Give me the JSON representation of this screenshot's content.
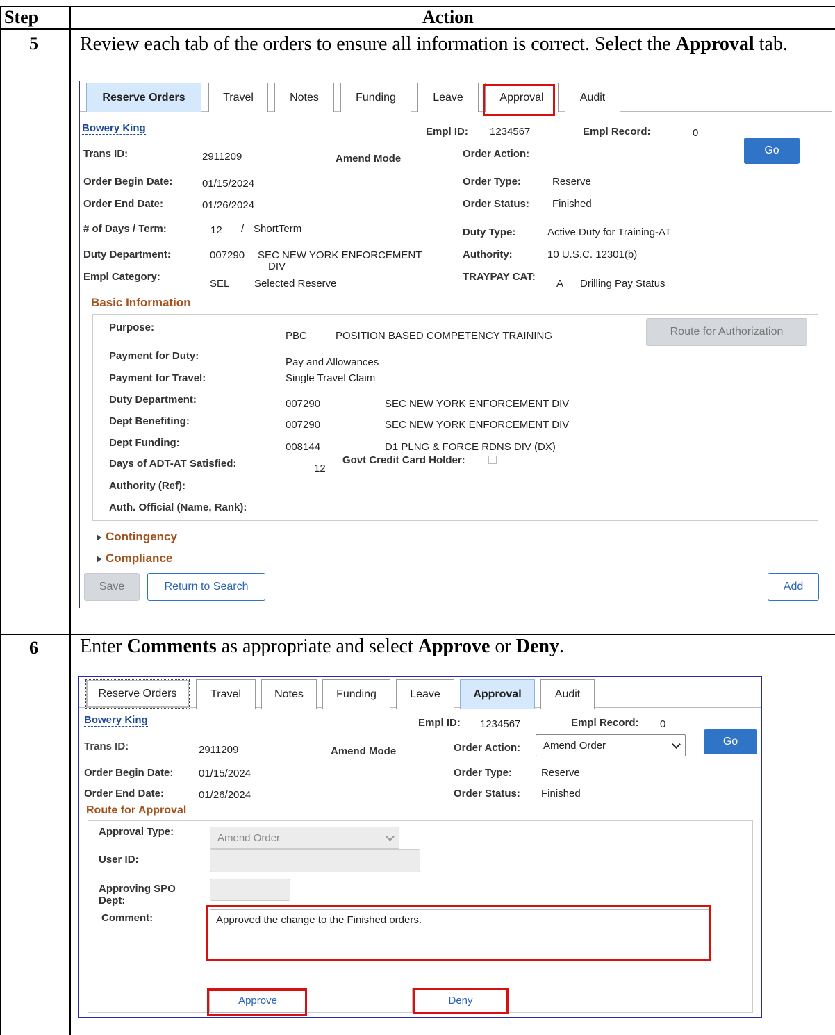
{
  "table": {
    "header_step": "Step",
    "header_action": "Action"
  },
  "step5": {
    "number": "5",
    "text_before": "Review each tab of the orders to ensure all information is correct. Select the ",
    "text_bold": "Approval",
    "text_after": " tab."
  },
  "step6": {
    "number": "6",
    "text_1": "Enter ",
    "bold_1": "Comments",
    "text_2": " as appropriate and select ",
    "bold_2": "Approve",
    "text_3": " or ",
    "bold_3": "Deny",
    "text_4": "."
  },
  "tabs": [
    "Reserve Orders",
    "Travel",
    "Notes",
    "Funding",
    "Leave",
    "Approval",
    "Audit"
  ],
  "shot1": {
    "employee_name": "Bowery King",
    "empl_id_label": "Empl ID:",
    "empl_id": "1234567",
    "empl_record_label": "Empl Record:",
    "empl_record": "0",
    "go_label": "Go",
    "trans_id_label": "Trans ID:",
    "trans_id": "2911209",
    "mode": "Amend Mode",
    "order_action_label": "Order Action:",
    "begin_label": "Order Begin Date:",
    "begin": "01/15/2024",
    "order_type_label": "Order Type:",
    "order_type": "Reserve",
    "end_label": "Order End Date:",
    "end": "01/26/2024",
    "order_status_label": "Order Status:",
    "order_status": "Finished",
    "days_label": "# of Days / Term:",
    "days": "12",
    "term_sep": "/",
    "term": "ShortTerm",
    "duty_type_label": "Duty Type:",
    "duty_type": "Active Duty for Training-AT",
    "duty_dept_label": "Duty Department:",
    "duty_dept_code": "007290",
    "duty_dept_name_1": "SEC NEW YORK ENFORCEMENT",
    "duty_dept_name_2": "DIV",
    "authority_label": "Authority:",
    "authority": "10 U.S.C. 12301(b)",
    "empl_cat_label": "Empl Category:",
    "empl_cat_code": "SEL",
    "empl_cat": "Selected Reserve",
    "traypay_label": "TRAYPAY CAT:",
    "traypay_code": "A",
    "traypay": "Drilling Pay Status",
    "basic_info_title": "Basic Information",
    "purpose_label": "Purpose:",
    "purpose_code": "PBC",
    "purpose": "POSITION BASED COMPETENCY TRAINING",
    "route_auth_label": "Route for Authorization",
    "pay_duty_label": "Payment for Duty:",
    "pay_duty": "Pay and Allowances",
    "pay_travel_label": "Payment for Travel:",
    "pay_travel": "Single Travel Claim",
    "bi_duty_dept_label": "Duty Department:",
    "bi_duty_dept_code": "007290",
    "bi_duty_dept": "SEC NEW YORK ENFORCEMENT DIV",
    "dept_benef_label": "Dept Benefiting:",
    "dept_benef_code": "007290",
    "dept_benef": "SEC NEW YORK ENFORCEMENT DIV",
    "dept_fund_label": "Dept Funding:",
    "dept_fund_code": "008144",
    "dept_fund": "D1 PLNG & FORCE RDNS DIV (DX)",
    "days_sat_label": "Days of ADT-AT Satisfied:",
    "days_sat": "12",
    "govt_cc_label": "Govt Credit Card Holder:",
    "authority_ref_label": "Authority (Ref):",
    "auth_official_label": "Auth. Official (Name, Rank):",
    "contingency": "Contingency",
    "compliance": "Compliance",
    "save_label": "Save",
    "return_label": "Return to Search",
    "add_label": "Add"
  },
  "shot2": {
    "employee_name": "Bowery King",
    "empl_id_label": "Empl ID:",
    "empl_id": "1234567",
    "empl_record_label": "Empl Record:",
    "empl_record": "0",
    "go_label": "Go",
    "trans_id_label": "Trans ID:",
    "trans_id": "2911209",
    "mode": "Amend Mode",
    "order_action_label": "Order Action:",
    "order_action": "Amend Order",
    "begin_label": "Order Begin Date:",
    "begin": "01/15/2024",
    "order_type_label": "Order Type:",
    "order_type": "Reserve",
    "end_label": "Order End Date:",
    "end": "01/26/2024",
    "order_status_label": "Order Status:",
    "order_status": "Finished",
    "route_title": "Route for Approval",
    "approval_type_label": "Approval Type:",
    "approval_type": "Amend Order",
    "user_id_label": "User ID:",
    "spo_label_1": "Approving SPO",
    "spo_label_2": "Dept:",
    "comment_label": "Comment:",
    "comment": "Approved the change to the Finished orders.",
    "approve_label": "Approve",
    "deny_label": "Deny"
  }
}
